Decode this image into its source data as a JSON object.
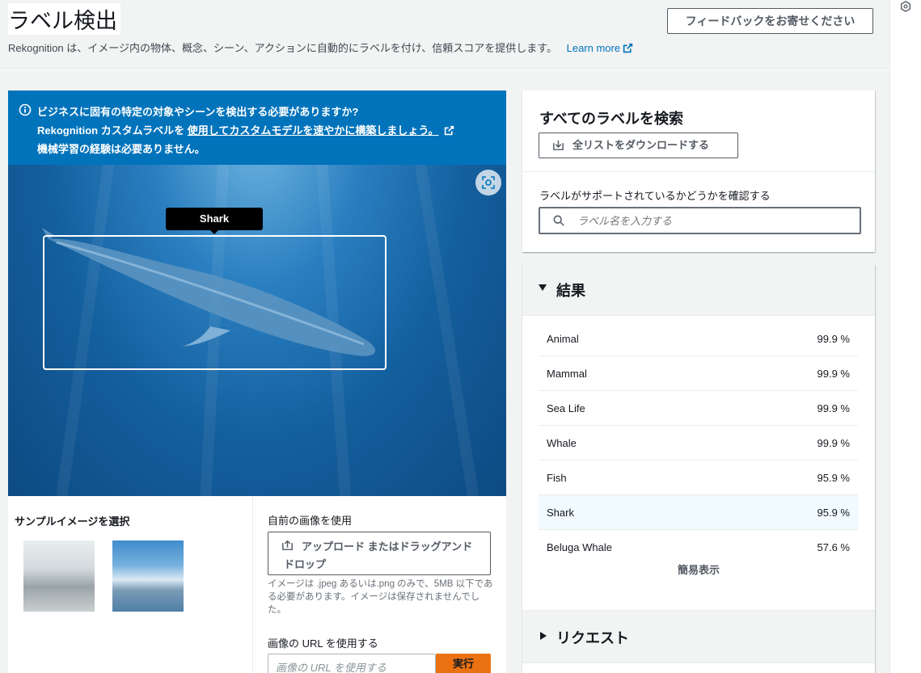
{
  "header": {
    "title": "ラベル検出",
    "subtitle": "Rekognition は、イメージ内の物体、概念、シーン、アクションに自動的にラベルを付け、信頼スコアを提供します。",
    "learn_more": "Learn more",
    "feedback_label": "フィードバックをお寄せください"
  },
  "info_banner": {
    "line1": "ビジネスに固有の特定の対象やシーンを検出する必要がありますか?",
    "line2_prefix": "Rekognition カスタムラベルを",
    "line2_link": "使用してカスタムモデルを速やかに構築しましょう。",
    "line3": "機械学習の経験は必要ありません。"
  },
  "image": {
    "detected_label": "Shark"
  },
  "samples": {
    "title": "サンプルイメージを選択"
  },
  "own_image": {
    "title": "自前の画像を使用",
    "upload_label": "アップロード またはドラッグアンドドロップ",
    "hint": "イメージは .jpeg あるいは.png のみで、5MB 以下である必要があります。イメージは保存されませんでした。",
    "url_title": "画像の URL を使用する",
    "url_placeholder": "画像の URL を使用する",
    "run_label": "実行"
  },
  "search_labels": {
    "title": "すべてのラベルを検索",
    "download_label": "全リストをダウンロードする",
    "check_label": "ラベルがサポートされているかどうかを確認する",
    "search_placeholder": "ラベル名を入力する"
  },
  "results": {
    "title": "結果",
    "items": [
      {
        "label": "Animal",
        "value": "99.9 %"
      },
      {
        "label": "Mammal",
        "value": "99.9 %"
      },
      {
        "label": "Sea Life",
        "value": "99.9 %"
      },
      {
        "label": "Whale",
        "value": "99.9 %"
      },
      {
        "label": "Fish",
        "value": "95.9 %"
      },
      {
        "label": "Shark",
        "value": "95.9 %"
      },
      {
        "label": "Beluga Whale",
        "value": "57.6 %"
      }
    ],
    "compact_label": "簡易表示"
  },
  "request": {
    "title": "リクエスト"
  },
  "colors": {
    "accent": "#0073bb",
    "run_button": "#ec7211",
    "highlight_row": "#f1faff"
  },
  "icons": [
    "external-link-icon",
    "info-icon",
    "focus-icon",
    "upload-icon",
    "download-icon",
    "search-icon",
    "caret-down-icon",
    "caret-right-icon",
    "panel-icon"
  ]
}
